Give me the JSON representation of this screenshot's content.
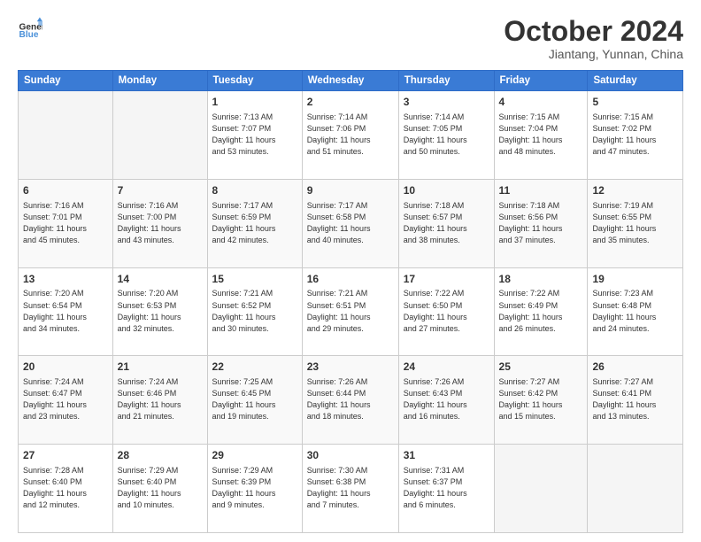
{
  "header": {
    "logo_line1": "General",
    "logo_line2": "Blue",
    "month": "October 2024",
    "location": "Jiantang, Yunnan, China"
  },
  "weekdays": [
    "Sunday",
    "Monday",
    "Tuesday",
    "Wednesday",
    "Thursday",
    "Friday",
    "Saturday"
  ],
  "weeks": [
    [
      {
        "day": "",
        "text": ""
      },
      {
        "day": "",
        "text": ""
      },
      {
        "day": "1",
        "text": "Sunrise: 7:13 AM\nSunset: 7:07 PM\nDaylight: 11 hours\nand 53 minutes."
      },
      {
        "day": "2",
        "text": "Sunrise: 7:14 AM\nSunset: 7:06 PM\nDaylight: 11 hours\nand 51 minutes."
      },
      {
        "day": "3",
        "text": "Sunrise: 7:14 AM\nSunset: 7:05 PM\nDaylight: 11 hours\nand 50 minutes."
      },
      {
        "day": "4",
        "text": "Sunrise: 7:15 AM\nSunset: 7:04 PM\nDaylight: 11 hours\nand 48 minutes."
      },
      {
        "day": "5",
        "text": "Sunrise: 7:15 AM\nSunset: 7:02 PM\nDaylight: 11 hours\nand 47 minutes."
      }
    ],
    [
      {
        "day": "6",
        "text": "Sunrise: 7:16 AM\nSunset: 7:01 PM\nDaylight: 11 hours\nand 45 minutes."
      },
      {
        "day": "7",
        "text": "Sunrise: 7:16 AM\nSunset: 7:00 PM\nDaylight: 11 hours\nand 43 minutes."
      },
      {
        "day": "8",
        "text": "Sunrise: 7:17 AM\nSunset: 6:59 PM\nDaylight: 11 hours\nand 42 minutes."
      },
      {
        "day": "9",
        "text": "Sunrise: 7:17 AM\nSunset: 6:58 PM\nDaylight: 11 hours\nand 40 minutes."
      },
      {
        "day": "10",
        "text": "Sunrise: 7:18 AM\nSunset: 6:57 PM\nDaylight: 11 hours\nand 38 minutes."
      },
      {
        "day": "11",
        "text": "Sunrise: 7:18 AM\nSunset: 6:56 PM\nDaylight: 11 hours\nand 37 minutes."
      },
      {
        "day": "12",
        "text": "Sunrise: 7:19 AM\nSunset: 6:55 PM\nDaylight: 11 hours\nand 35 minutes."
      }
    ],
    [
      {
        "day": "13",
        "text": "Sunrise: 7:20 AM\nSunset: 6:54 PM\nDaylight: 11 hours\nand 34 minutes."
      },
      {
        "day": "14",
        "text": "Sunrise: 7:20 AM\nSunset: 6:53 PM\nDaylight: 11 hours\nand 32 minutes."
      },
      {
        "day": "15",
        "text": "Sunrise: 7:21 AM\nSunset: 6:52 PM\nDaylight: 11 hours\nand 30 minutes."
      },
      {
        "day": "16",
        "text": "Sunrise: 7:21 AM\nSunset: 6:51 PM\nDaylight: 11 hours\nand 29 minutes."
      },
      {
        "day": "17",
        "text": "Sunrise: 7:22 AM\nSunset: 6:50 PM\nDaylight: 11 hours\nand 27 minutes."
      },
      {
        "day": "18",
        "text": "Sunrise: 7:22 AM\nSunset: 6:49 PM\nDaylight: 11 hours\nand 26 minutes."
      },
      {
        "day": "19",
        "text": "Sunrise: 7:23 AM\nSunset: 6:48 PM\nDaylight: 11 hours\nand 24 minutes."
      }
    ],
    [
      {
        "day": "20",
        "text": "Sunrise: 7:24 AM\nSunset: 6:47 PM\nDaylight: 11 hours\nand 23 minutes."
      },
      {
        "day": "21",
        "text": "Sunrise: 7:24 AM\nSunset: 6:46 PM\nDaylight: 11 hours\nand 21 minutes."
      },
      {
        "day": "22",
        "text": "Sunrise: 7:25 AM\nSunset: 6:45 PM\nDaylight: 11 hours\nand 19 minutes."
      },
      {
        "day": "23",
        "text": "Sunrise: 7:26 AM\nSunset: 6:44 PM\nDaylight: 11 hours\nand 18 minutes."
      },
      {
        "day": "24",
        "text": "Sunrise: 7:26 AM\nSunset: 6:43 PM\nDaylight: 11 hours\nand 16 minutes."
      },
      {
        "day": "25",
        "text": "Sunrise: 7:27 AM\nSunset: 6:42 PM\nDaylight: 11 hours\nand 15 minutes."
      },
      {
        "day": "26",
        "text": "Sunrise: 7:27 AM\nSunset: 6:41 PM\nDaylight: 11 hours\nand 13 minutes."
      }
    ],
    [
      {
        "day": "27",
        "text": "Sunrise: 7:28 AM\nSunset: 6:40 PM\nDaylight: 11 hours\nand 12 minutes."
      },
      {
        "day": "28",
        "text": "Sunrise: 7:29 AM\nSunset: 6:40 PM\nDaylight: 11 hours\nand 10 minutes."
      },
      {
        "day": "29",
        "text": "Sunrise: 7:29 AM\nSunset: 6:39 PM\nDaylight: 11 hours\nand 9 minutes."
      },
      {
        "day": "30",
        "text": "Sunrise: 7:30 AM\nSunset: 6:38 PM\nDaylight: 11 hours\nand 7 minutes."
      },
      {
        "day": "31",
        "text": "Sunrise: 7:31 AM\nSunset: 6:37 PM\nDaylight: 11 hours\nand 6 minutes."
      },
      {
        "day": "",
        "text": ""
      },
      {
        "day": "",
        "text": ""
      }
    ]
  ]
}
